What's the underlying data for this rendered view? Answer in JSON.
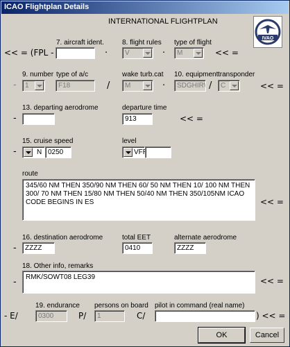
{
  "window": {
    "title": "ICAO Flightplan Details"
  },
  "heading": "INTERNATIONAL FLIGHTPLAN",
  "logo": {
    "text": "IVAO",
    "color": "#2a3a6a"
  },
  "row1": {
    "prefix": "<< = (FPL -",
    "aircraft_ident_label": "7. aircraft ident.",
    "aircraft_ident_value": "",
    "flight_rules_label": "8. flight rules",
    "flight_rules_value": "V",
    "type_of_flight_label": "type of flight",
    "type_of_flight_value": "M",
    "suffix": "<< ="
  },
  "row2": {
    "number_label": "9. number",
    "number_value": "1",
    "type_ac_label": "type of a/c",
    "type_ac_value": "F18",
    "wake_label": "wake turb.cat",
    "wake_value": "M",
    "equipment_label": "10. equipment",
    "equipment_value": "SDGHIRW",
    "transponder_label": "transponder",
    "transponder_value": "C",
    "suffix": "<< ="
  },
  "row3": {
    "departing_label": "13. departing aerodrome",
    "departing_value": "",
    "departure_time_label": "departure time",
    "departure_time_value": "913",
    "suffix": "<< ="
  },
  "row4": {
    "cruise_label": "15. cruise speed",
    "cruise_unit": "N",
    "cruise_value": "0250",
    "level_label": "level",
    "level_unit": "VFR",
    "level_value": ""
  },
  "route": {
    "label": "route",
    "value": "345/60 NM THEN 350/90 NM THEN 60/ 50 NM THEN 10/ 100 NM THEN 300/ 70 NM THEN 15/80 NM THEN 50/40 NM THEN 350/105NM ICAO CODE BEGINS IN ES",
    "suffix": "<< ="
  },
  "row6": {
    "destination_label": "16. destination aerodrome",
    "destination_value": "ZZZZ",
    "eet_label": "total EET",
    "eet_value": "0410",
    "alternate_label": "alternate aerodrome",
    "alternate_value": "ZZZZ"
  },
  "remarks": {
    "label": "18. Other info, remarks",
    "value": "RMK/SOWT08 LEG39",
    "suffix": "<< ="
  },
  "row8": {
    "prefix": "- E/",
    "endurance_label": "19. endurance",
    "endurance_value": "0300",
    "p_sep": "P/",
    "persons_label": "persons on board",
    "persons_value": "1",
    "c_sep": "C/",
    "pilot_label": "pilot in command (real name)",
    "pilot_value": "",
    "suffix": ") << ="
  },
  "buttons": {
    "ok": "OK",
    "cancel": "Cancel"
  },
  "separators": {
    "dash": "-",
    "dot": "·",
    "slash": "/"
  }
}
